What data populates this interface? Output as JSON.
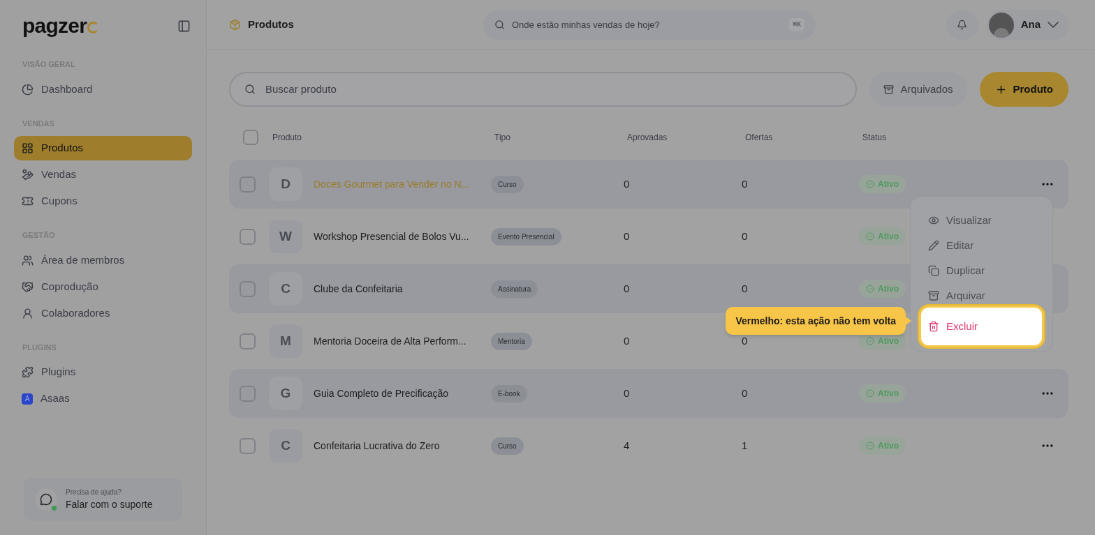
{
  "sidebar": {
    "logo": "pagzer",
    "sections": [
      {
        "title": "VISÃO GERAL",
        "items": [
          {
            "label": "Dashboard",
            "selected": false
          }
        ]
      },
      {
        "title": "VENDAS",
        "items": [
          {
            "label": "Produtos",
            "selected": true
          },
          {
            "label": "Vendas",
            "selected": false
          },
          {
            "label": "Cupons",
            "selected": false
          }
        ]
      },
      {
        "title": "GESTÃO",
        "items": [
          {
            "label": "Área de membros",
            "selected": false
          },
          {
            "label": "Coprodução",
            "selected": false
          },
          {
            "label": "Colaboradores",
            "selected": false
          }
        ]
      },
      {
        "title": "PLUGINS",
        "items": [
          {
            "label": "Plugins",
            "selected": false
          },
          {
            "label": "Asaas",
            "selected": false,
            "badge": "A"
          }
        ]
      }
    ],
    "support": {
      "hint": "Precisa de ajuda?",
      "label": "Falar com o suporte"
    }
  },
  "header": {
    "title": "Produtos",
    "search_placeholder": "Onde estão minhas vendas de hoje?",
    "shortcut": "⌘K",
    "user": "Ana"
  },
  "toolbar": {
    "search_placeholder": "Buscar produto",
    "archived": "Arquivados",
    "add": "Produto"
  },
  "table": {
    "select_all_checked": false,
    "columns": [
      "Produto",
      "Tipo",
      "Aprovadas",
      "Ofertas",
      "Status"
    ],
    "rows": [
      {
        "initial": "D",
        "name": "Doces Gourmet para Vender no N...",
        "type": "Curso",
        "approved": "0",
        "offers": "0",
        "status": "Ativo",
        "selected": true,
        "checked": false
      },
      {
        "initial": "W",
        "name": "Workshop Presencial de Bolos Vu...",
        "type": "Evento Presencial",
        "approved": "0",
        "offers": "0",
        "status": "Ativo",
        "selected": false,
        "checked": false
      },
      {
        "initial": "C",
        "name": "Clube da Confeitaria",
        "type": "Assinatura",
        "approved": "0",
        "offers": "0",
        "status": "Ativo",
        "selected": false,
        "checked": false
      },
      {
        "initial": "M",
        "name": "Mentoria Doceira de Alta Perform...",
        "type": "Mentoria",
        "approved": "0",
        "offers": "0",
        "status": "Ativo",
        "selected": false,
        "checked": false
      },
      {
        "initial": "G",
        "name": "Guia Completo de Precificação",
        "type": "E-book",
        "approved": "0",
        "offers": "0",
        "status": "Ativo",
        "selected": false,
        "checked": false
      },
      {
        "initial": "C",
        "name": "Confeitaria Lucrativa do Zero",
        "type": "Curso",
        "approved": "4",
        "offers": "1",
        "status": "Ativo",
        "selected": false,
        "checked": false
      }
    ]
  },
  "menu": {
    "items": [
      {
        "label": "Visualizar",
        "kind": "view",
        "highlighted": false
      },
      {
        "label": "Editar",
        "kind": "edit",
        "highlighted": false
      },
      {
        "label": "Duplicar",
        "kind": "duplicate",
        "highlighted": false
      },
      {
        "label": "Arquivar",
        "kind": "archive",
        "highlighted": false
      },
      {
        "label": "Excluir",
        "kind": "delete",
        "highlighted": true
      }
    ]
  },
  "tooltip": "Vermelho: esta ação não tem volta"
}
